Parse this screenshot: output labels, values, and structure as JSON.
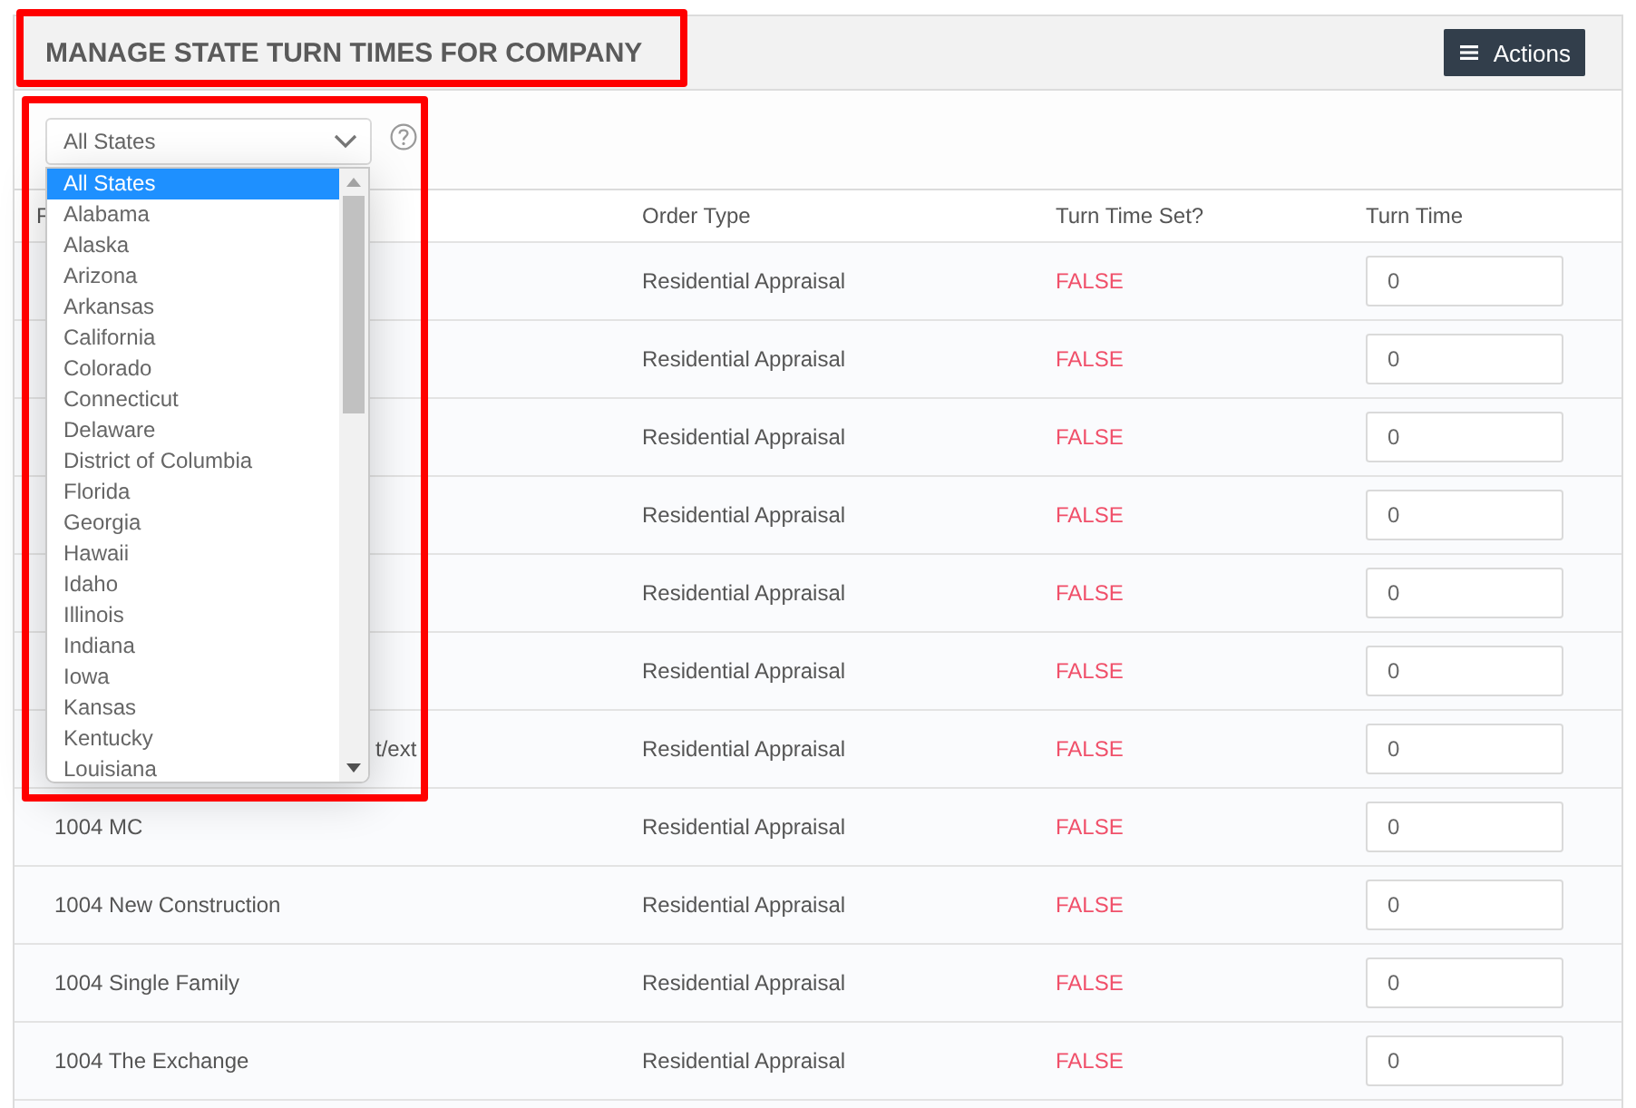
{
  "panel": {
    "title": "MANAGE STATE TURN TIMES FOR COMPANY",
    "title_highlighted": true,
    "actions_button": {
      "label": "Actions"
    }
  },
  "state_filter": {
    "value": "All States",
    "highlighted": true,
    "expanded": true,
    "options": [
      {
        "label": "All States",
        "selected": true
      },
      {
        "label": "Alabama",
        "selected": false
      },
      {
        "label": "Alaska",
        "selected": false
      },
      {
        "label": "Arizona",
        "selected": false
      },
      {
        "label": "Arkansas",
        "selected": false
      },
      {
        "label": "California",
        "selected": false
      },
      {
        "label": "Colorado",
        "selected": false
      },
      {
        "label": "Connecticut",
        "selected": false
      },
      {
        "label": "Delaware",
        "selected": false
      },
      {
        "label": "District of Columbia",
        "selected": false
      },
      {
        "label": "Florida",
        "selected": false
      },
      {
        "label": "Georgia",
        "selected": false
      },
      {
        "label": "Hawaii",
        "selected": false
      },
      {
        "label": "Idaho",
        "selected": false
      },
      {
        "label": "Illinois",
        "selected": false
      },
      {
        "label": "Indiana",
        "selected": false
      },
      {
        "label": "Iowa",
        "selected": false
      },
      {
        "label": "Kansas",
        "selected": false
      },
      {
        "label": "Kentucky",
        "selected": false
      },
      {
        "label": "Louisiana",
        "selected": false
      }
    ]
  },
  "table": {
    "columns": [
      "F",
      "Order Type",
      "Turn Time Set?",
      "Turn Time"
    ],
    "rows": [
      {
        "order_type": "Residential Appraisal",
        "turn_time_set": "FALSE",
        "turn_time": "0"
      },
      {
        "order_type": "Residential Appraisal",
        "turn_time_set": "FALSE",
        "turn_time": "0"
      },
      {
        "order_type": "Residential Appraisal",
        "turn_time_set": "FALSE",
        "turn_time": "0"
      },
      {
        "order_type": "Residential Appraisal",
        "turn_time_set": "FALSE",
        "turn_time": "0"
      },
      {
        "order_type": "Residential Appraisal",
        "turn_time_set": "FALSE",
        "turn_time": "0"
      },
      {
        "order_type": "Residential Appraisal",
        "turn_time_set": "FALSE",
        "turn_time": "0"
      },
      {
        "column_1_tail": "t/ext",
        "order_type": "Residential Appraisal",
        "turn_time_set": "FALSE",
        "turn_time": "0"
      },
      {
        "column_1": "1004 MC",
        "order_type": "Residential Appraisal",
        "turn_time_set": "FALSE",
        "turn_time": "0"
      },
      {
        "column_1": "1004 New Construction",
        "order_type": "Residential Appraisal",
        "turn_time_set": "FALSE",
        "turn_time": "0"
      },
      {
        "column_1": "1004 Single Family",
        "order_type": "Residential Appraisal",
        "turn_time_set": "FALSE",
        "turn_time": "0"
      },
      {
        "column_1": "1004 The Exchange",
        "order_type": "Residential Appraisal",
        "turn_time_set": "FALSE",
        "turn_time": "0"
      }
    ]
  }
}
